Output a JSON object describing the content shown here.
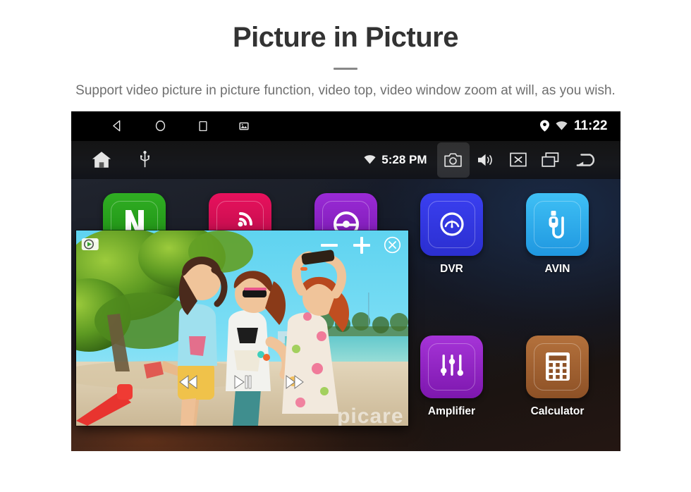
{
  "header": {
    "title": "Picture in Picture",
    "subtitle": "Support video picture in picture function, video top, video window zoom at will, as you wish."
  },
  "device": {
    "status_bar": {
      "nav_items": [
        {
          "name": "back-icon",
          "label": "Back"
        },
        {
          "name": "home-icon",
          "label": "Home"
        },
        {
          "name": "recents-icon",
          "label": "Recents"
        },
        {
          "name": "screenshot-icon",
          "label": "Screenshot"
        }
      ],
      "location_icon": "location-pin-icon",
      "wifi_icon": "wifi-icon",
      "clock": "11:22"
    },
    "system_bar": {
      "home_label": "Home",
      "usb_label": "USB",
      "wifi_icon": "wifi-icon",
      "time": "5:28 PM",
      "buttons": [
        {
          "name": "camera-button",
          "label": "Camera",
          "active": true
        },
        {
          "name": "volume-button",
          "label": "Volume",
          "active": false
        },
        {
          "name": "close-app-button",
          "label": "Close",
          "active": false
        },
        {
          "name": "recent-apps-button",
          "label": "Recent Apps",
          "active": false
        },
        {
          "name": "back-button",
          "label": "Back",
          "active": false
        }
      ]
    },
    "apps": [
      {
        "label": "Netflix",
        "color_top": "#2fae22",
        "color_bottom": "#1d8a14",
        "glyph": "netflix-icon",
        "col": 0,
        "row": 0
      },
      {
        "label": "SiriusXM",
        "color_top": "#e8115d",
        "color_bottom": "#b30c47",
        "glyph": "siriusxm-icon",
        "col": 1,
        "row": 0
      },
      {
        "label": "Wheelkey Study",
        "color_top": "#9a2ad6",
        "color_bottom": "#7418ab",
        "glyph": "wheelkey-icon",
        "col": 2,
        "row": 0
      },
      {
        "label": "DVR",
        "color_top": "#3a3ff0",
        "color_bottom": "#2b2fd0",
        "glyph": "gauge-icon",
        "col": 3,
        "row": 0
      },
      {
        "label": "AVIN",
        "color_top": "#3fc0f5",
        "color_bottom": "#1f97e0",
        "glyph": "rca-plug-icon",
        "col": 4,
        "row": 0
      },
      {
        "label": "Amplifier",
        "color_top": "#a634d8",
        "color_bottom": "#7d17ae",
        "glyph": "equalizer-icon",
        "col": 3,
        "row": 1
      },
      {
        "label": "Calculator",
        "color_top": "#b4713c",
        "color_bottom": "#8d5126",
        "glyph": "calculator-icon",
        "col": 4,
        "row": 1
      }
    ],
    "pip": {
      "badge_icon": "video-badge-icon",
      "zoom_out_label": "Zoom out",
      "zoom_in_label": "Zoom in",
      "close_label": "Close",
      "prev_label": "Previous",
      "play_label": "Play / Pause",
      "next_label": "Next",
      "watermark": "picare"
    }
  },
  "colors": {
    "page_bg": "#ffffff",
    "title": "#333333",
    "subtitle": "#6f6f6f",
    "rule": "#888888",
    "statusbar_bg": "#000000",
    "pip_sky": "#6fd8ef"
  }
}
